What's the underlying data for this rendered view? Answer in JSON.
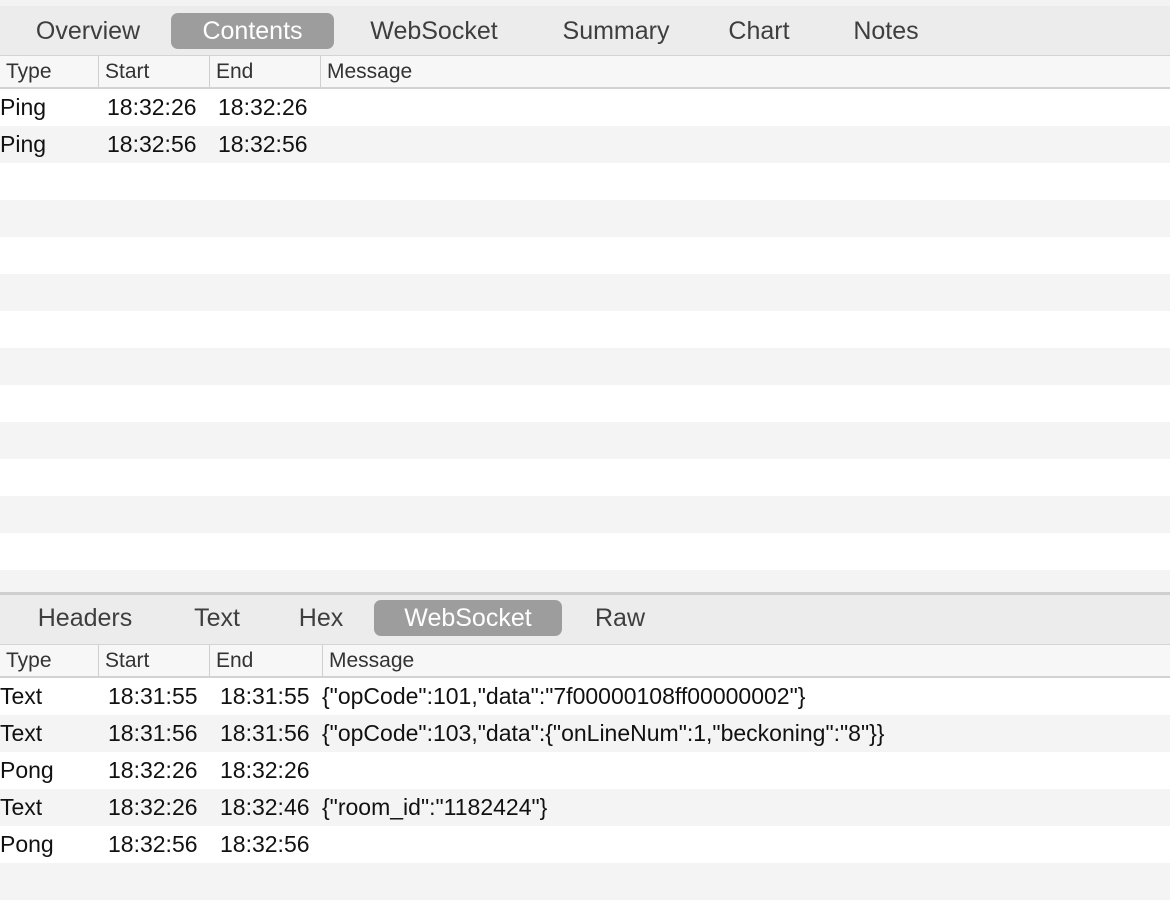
{
  "top": {
    "tabs": [
      "Overview",
      "Contents",
      "WebSocket",
      "Summary",
      "Chart",
      "Notes"
    ],
    "active_tab": "Contents",
    "columns": [
      "Type",
      "Start",
      "End",
      "Message"
    ],
    "rows": [
      {
        "type": "Ping",
        "start": "18:32:26",
        "end": "18:32:26",
        "message": ""
      },
      {
        "type": "Ping",
        "start": "18:32:56",
        "end": "18:32:56",
        "message": ""
      }
    ]
  },
  "bottom": {
    "tabs": [
      "Headers",
      "Text",
      "Hex",
      "WebSocket",
      "Raw"
    ],
    "active_tab": "WebSocket",
    "columns": [
      "Type",
      "Start",
      "End",
      "Message"
    ],
    "rows": [
      {
        "type": "Text",
        "start": "18:31:55",
        "end": "18:31:55",
        "message": "{\"opCode\":101,\"data\":\"7f00000108ff00000002\"}"
      },
      {
        "type": "Text",
        "start": "18:31:56",
        "end": "18:31:56",
        "message": "{\"opCode\":103,\"data\":{\"onLineNum\":1,\"beckoning\":\"8\"}}"
      },
      {
        "type": "Pong",
        "start": "18:32:26",
        "end": "18:32:26",
        "message": ""
      },
      {
        "type": "Text",
        "start": "18:32:26",
        "end": "18:32:46",
        "message": "{\"room_id\":\"1182424\"}"
      },
      {
        "type": "Pong",
        "start": "18:32:56",
        "end": "18:32:56",
        "message": ""
      }
    ]
  }
}
